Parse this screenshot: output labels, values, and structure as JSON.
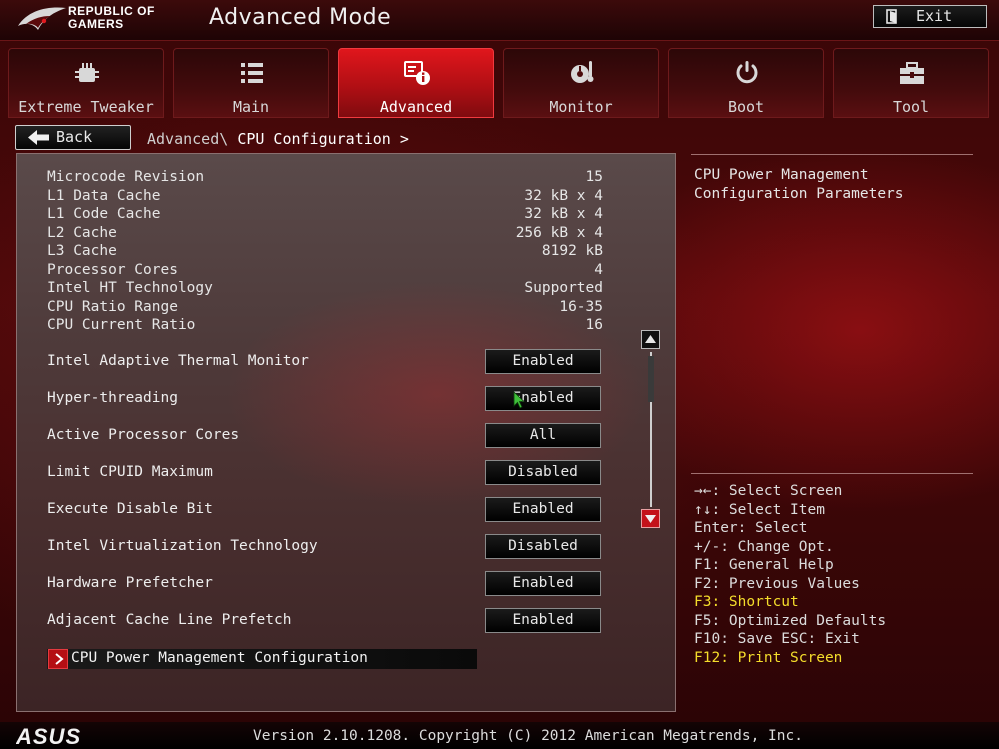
{
  "brand": {
    "line1": "REPUBLIC OF",
    "line2": "GAMERS"
  },
  "mode_title": "Advanced Mode",
  "exit_label": "Exit",
  "tabs": [
    {
      "label": "Extreme Tweaker",
      "icon": "tweaker-icon",
      "active": false
    },
    {
      "label": "Main",
      "icon": "list-icon",
      "active": false
    },
    {
      "label": "Advanced",
      "icon": "advanced-settings-icon",
      "active": true
    },
    {
      "label": "Monitor",
      "icon": "monitor-icon",
      "active": false
    },
    {
      "label": "Boot",
      "icon": "power-icon",
      "active": false
    },
    {
      "label": "Tool",
      "icon": "toolbox-icon",
      "active": false
    }
  ],
  "back_label": "Back",
  "breadcrumb": {
    "parent": "Advanced\\",
    "current": "CPU Configuration >"
  },
  "info": [
    {
      "key": "Microcode Revision",
      "value": "15"
    },
    {
      "key": "L1 Data Cache",
      "value": "32 kB x 4"
    },
    {
      "key": "L1 Code Cache",
      "value": "32 kB x 4"
    },
    {
      "key": "L2 Cache",
      "value": "256 kB x 4"
    },
    {
      "key": "L3 Cache",
      "value": "8192 kB"
    },
    {
      "key": "Processor Cores",
      "value": "4"
    },
    {
      "key": "Intel HT Technology",
      "value": "Supported"
    },
    {
      "key": "CPU Ratio Range",
      "value": "16-35"
    },
    {
      "key": "CPU Current Ratio",
      "value": "16"
    }
  ],
  "options": [
    {
      "key": "Intel Adaptive Thermal Monitor",
      "value": "Enabled"
    },
    {
      "key": "Hyper-threading",
      "value": "Enabled"
    },
    {
      "key": "Active Processor Cores",
      "value": "All"
    },
    {
      "key": "Limit CPUID Maximum",
      "value": "Disabled"
    },
    {
      "key": "Execute Disable Bit",
      "value": "Enabled"
    },
    {
      "key": "Intel Virtualization Technology",
      "value": "Disabled"
    },
    {
      "key": "Hardware Prefetcher",
      "value": "Enabled"
    },
    {
      "key": "Adjacent Cache Line Prefetch",
      "value": "Enabled"
    }
  ],
  "submenu_label": "CPU Power Management Configuration",
  "help_text": "CPU Power Management Configuration Parameters",
  "keys": [
    {
      "text": "→←: Select Screen",
      "highlight": false
    },
    {
      "text": "↑↓: Select Item",
      "highlight": false
    },
    {
      "text": "Enter: Select",
      "highlight": false
    },
    {
      "text": "+/-: Change Opt.",
      "highlight": false
    },
    {
      "text": "F1: General Help",
      "highlight": false
    },
    {
      "text": "F2: Previous Values",
      "highlight": false
    },
    {
      "text": "F3: Shortcut",
      "highlight": true
    },
    {
      "text": "F5: Optimized Defaults",
      "highlight": false
    },
    {
      "text": "F10: Save  ESC: Exit",
      "highlight": false
    },
    {
      "text": "F12: Print Screen",
      "highlight": true
    }
  ],
  "footer": {
    "logo": "ASUS",
    "version": "Version 2.10.1208. Copyright (C) 2012 American Megatrends, Inc."
  },
  "colors": {
    "accent": "#c4121a",
    "highlight": "#f4dd2b"
  }
}
